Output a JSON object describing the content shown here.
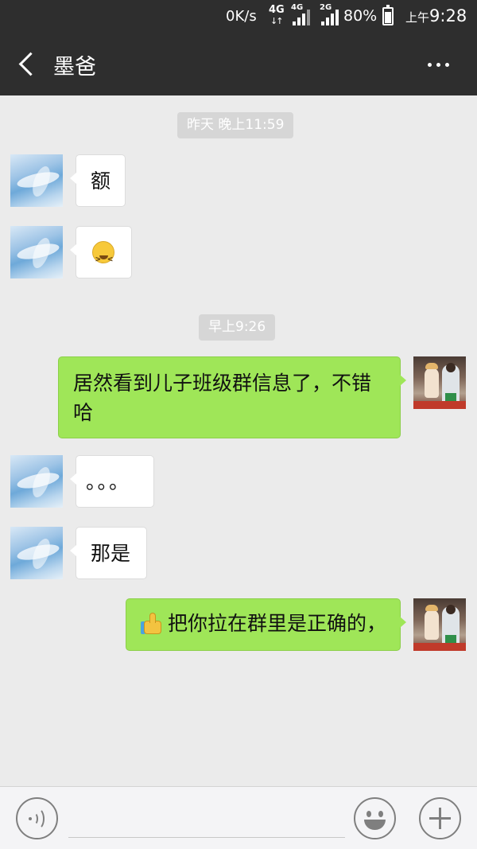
{
  "status_bar": {
    "network_speed": "0K/s",
    "network_type": "4G",
    "sim1_label": "4G",
    "sim2_label": "2G",
    "battery_percent": "80%",
    "battery_level": 0.8,
    "time_period": "上午",
    "time": "9:28"
  },
  "header": {
    "back_icon": "chevron-left-icon",
    "title": "墨爸",
    "more_icon": "more-dots-icon"
  },
  "messages": [
    {
      "type": "timestamp",
      "text": "昨天 晚上11:59"
    },
    {
      "type": "incoming",
      "text": "额"
    },
    {
      "type": "incoming",
      "emoji": "squinting-face-emoji"
    },
    {
      "type": "timestamp",
      "text": "早上9:26"
    },
    {
      "type": "outgoing",
      "text": "居然看到儿子班级群信息了，不错哈"
    },
    {
      "type": "incoming",
      "text": "。。。"
    },
    {
      "type": "incoming",
      "text": "那是"
    },
    {
      "type": "outgoing",
      "emoji": "thumbs-up-emoji",
      "text": "把你拉在群里是正确的，"
    }
  ],
  "input_bar": {
    "voice_icon": "voice-icon",
    "input_value": "",
    "emoji_icon": "smiley-icon",
    "plus_icon": "plus-icon"
  },
  "colors": {
    "header_bg": "#2e2e2e",
    "chat_bg": "#ebebeb",
    "outgoing_bubble": "#9fe658",
    "incoming_bubble": "#ffffff",
    "timestamp_bg": "#d6d6d6"
  }
}
